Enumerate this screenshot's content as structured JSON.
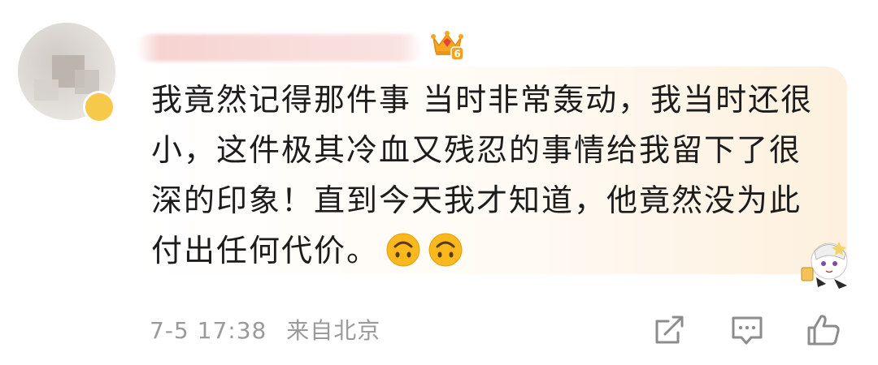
{
  "comment": {
    "username": "",
    "user_level": "6",
    "text": "我竟然记得那件事 当时非常轰动，我当时还很小，这件极其冷血又残忍的事情给我留下了很深的印象！直到今天我才知道，他竟然没为此付出任何代价。",
    "emojis": [
      "upside-down-face",
      "upside-down-face"
    ],
    "timestamp": "7-5 17:38",
    "location": "来自北京"
  },
  "actions": [
    {
      "name": "share",
      "icon": "share-icon"
    },
    {
      "name": "reply",
      "icon": "comment-icon"
    },
    {
      "name": "like",
      "icon": "thumbs-up-icon"
    }
  ],
  "colors": {
    "text": "#1c1c1c",
    "meta": "#9a9a9a",
    "bubble_warm": "#fdf0de",
    "crown": "#f5a623",
    "crown_gem": "#e8413c"
  }
}
